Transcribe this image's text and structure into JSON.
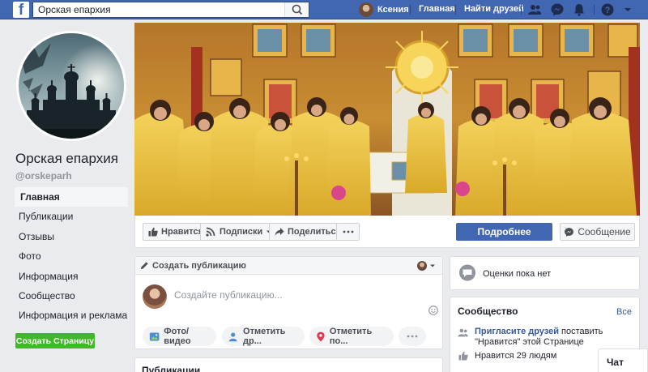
{
  "topbar": {
    "search_value": "Орская епархия",
    "user_name": "Ксения",
    "home": "Главная",
    "find_friends": "Найти друзей"
  },
  "page": {
    "name": "Орская епархия",
    "handle": "@orskeparh"
  },
  "left_nav": [
    {
      "label": "Главная",
      "active": true
    },
    {
      "label": "Публикации"
    },
    {
      "label": "Отзывы"
    },
    {
      "label": "Фото"
    },
    {
      "label": "Информация"
    },
    {
      "label": "Сообщество"
    },
    {
      "label": "Информация и реклама"
    }
  ],
  "create_page": "Создать Страницу",
  "actions": {
    "like": "Нравится",
    "follow": "Подписки",
    "share": "Поделиться",
    "more_info": "Подробнее",
    "message": "Сообщение"
  },
  "composer": {
    "title": "Создать публикацию",
    "placeholder": "Создайте публикацию...",
    "photo_video": "Фото/видео",
    "tag_friends": "Отметить др...",
    "check_in": "Отметить по..."
  },
  "publications_header": "Публикации",
  "rating": {
    "text": "Оценки пока нет"
  },
  "community": {
    "title": "Сообщество",
    "see_all": "Все",
    "invite_link": "Пригласите друзей",
    "invite_rest": " поставить \"Нравится\" этой Странице",
    "likes": "Нравится 29 людям"
  },
  "chat": "Чат",
  "colors": {
    "brand": "#4267b2",
    "create_green": "#42b72a"
  }
}
